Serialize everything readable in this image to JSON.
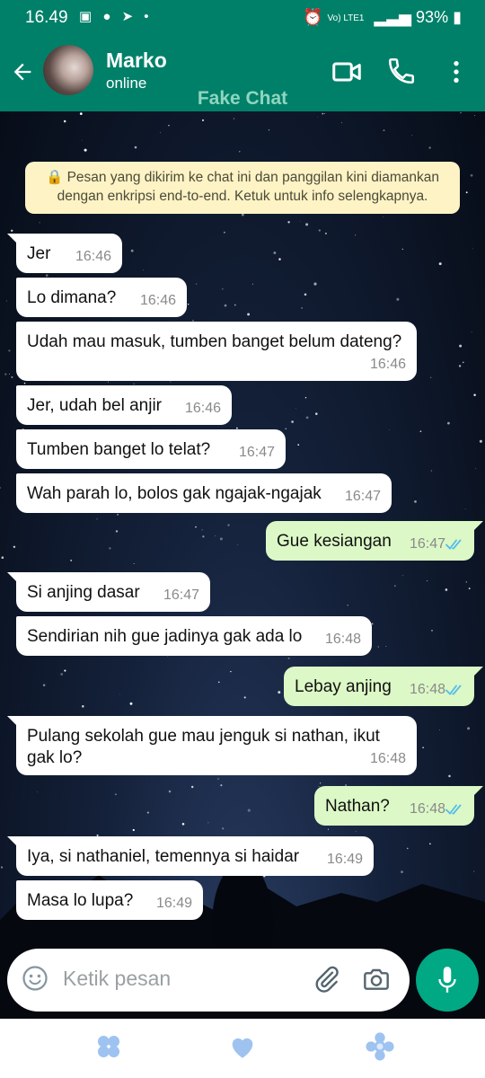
{
  "status_bar": {
    "time": "16.49",
    "left_icons": "▣ ● ➤ •",
    "network_label": "Vo) LTE1",
    "battery": "93%"
  },
  "header": {
    "contact_name": "Marko",
    "contact_status": "online",
    "overlay_label": "Fake Chat",
    "accent_color": "#008069"
  },
  "encryption_notice": "🔒 Pesan yang dikirim ke chat ini dan panggilan kini diamankan dengan enkripsi end-to-end. Ketuk untuk info selengkapnya.",
  "messages": [
    {
      "dir": "in",
      "text": "Jer",
      "time": "16:46"
    },
    {
      "dir": "in",
      "text": "Lo dimana?",
      "time": "16:46"
    },
    {
      "dir": "in",
      "text": "Udah mau masuk, tumben banget belum dateng?",
      "time": "16:46"
    },
    {
      "dir": "in",
      "text": "Jer, udah bel anjir",
      "time": "16:46"
    },
    {
      "dir": "in",
      "text": "Tumben banget lo telat?",
      "time": "16:47"
    },
    {
      "dir": "in",
      "text": "Wah parah lo, bolos gak ngajak-ngajak",
      "time": "16:47"
    },
    {
      "dir": "out",
      "text": "Gue kesiangan",
      "time": "16:47",
      "status": "read"
    },
    {
      "dir": "in",
      "text": "Si anjing dasar",
      "time": "16:47"
    },
    {
      "dir": "in",
      "text": "Sendirian nih gue jadinya gak ada lo",
      "time": "16:48"
    },
    {
      "dir": "out",
      "text": "Lebay anjing",
      "time": "16:48",
      "status": "read"
    },
    {
      "dir": "in",
      "text": "Pulang sekolah gue mau jenguk si nathan, ikut gak lo?",
      "time": "16:48"
    },
    {
      "dir": "out",
      "text": "Nathan?",
      "time": "16:48",
      "status": "read"
    },
    {
      "dir": "in",
      "text": "Iya, si nathaniel, temennya si haidar",
      "time": "16:49"
    },
    {
      "dir": "in",
      "text": "Masa lo lupa?",
      "time": "16:49"
    }
  ],
  "input": {
    "placeholder": "Ketik pesan"
  },
  "icons": {
    "back": "arrow-left-icon",
    "video": "video-call-icon",
    "call": "phone-icon",
    "menu": "more-vertical-icon",
    "emoji": "emoji-icon",
    "attach": "paperclip-icon",
    "camera": "camera-icon",
    "mic": "microphone-icon",
    "read_tick": "double-check-icon"
  },
  "colors": {
    "incoming_bubble": "#ffffff",
    "outgoing_bubble": "#dcf8c6",
    "read_tick": "#53bdeb",
    "mic_button": "#00a884",
    "notice_bg": "#fdf3c4"
  }
}
